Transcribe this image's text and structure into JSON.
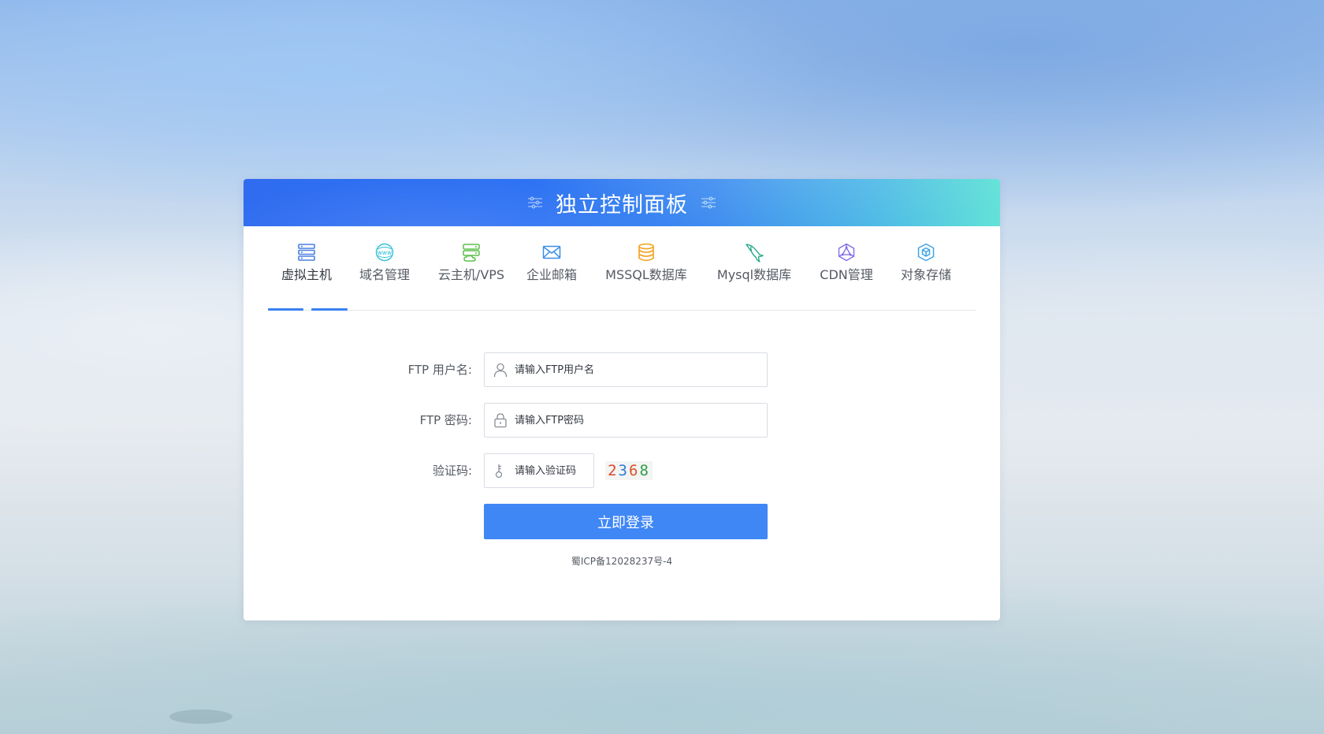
{
  "header": {
    "title": "独立控制面板"
  },
  "tabs": [
    {
      "label": "虚拟主机",
      "icon": "server-icon",
      "active": true
    },
    {
      "label": "域名管理",
      "icon": "www-globe-icon",
      "active": false
    },
    {
      "label": "云主机/VPS",
      "icon": "cloud-server-icon",
      "active": false
    },
    {
      "label": "企业邮箱",
      "icon": "mail-icon",
      "active": false
    },
    {
      "label": "MSSQL数据库",
      "icon": "database-icon",
      "active": false
    },
    {
      "label": "Mysql数据库",
      "icon": "mysql-dolphin-icon",
      "active": false
    },
    {
      "label": "CDN管理",
      "icon": "cdn-network-icon",
      "active": false
    },
    {
      "label": "对象存储",
      "icon": "cube-storage-icon",
      "active": false
    }
  ],
  "form": {
    "username": {
      "label": "FTP 用户名:",
      "placeholder": "请输入FTP用户名",
      "value": "",
      "icon": "user-icon"
    },
    "password": {
      "label": "FTP 密码:",
      "placeholder": "请输入FTP密码",
      "value": "",
      "icon": "lock-icon"
    },
    "captcha": {
      "label": "验证码:",
      "placeholder": "请输入验证码",
      "value": "",
      "icon": "key-icon",
      "image_chars": [
        "2",
        "3",
        "6",
        "8"
      ],
      "image_colors": [
        "#e0462c",
        "#2f7bd9",
        "#d9532f",
        "#2f9e4a"
      ]
    },
    "submit_label": "立即登录"
  },
  "footer": {
    "icp": "蜀ICP备12028237号-4"
  },
  "colors": {
    "primary": "#3f87f5",
    "header_start": "#2f6cf0",
    "header_end": "#63e2d8"
  }
}
